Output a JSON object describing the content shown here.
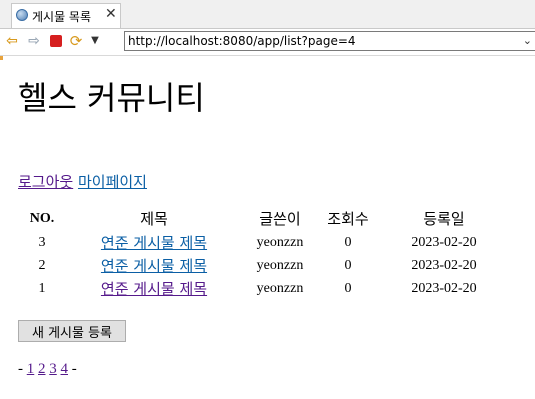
{
  "browser": {
    "tab_title": "게시물 목록",
    "url": "http://localhost:8080/app/list?page=4"
  },
  "page": {
    "title": "헬스 커뮤니티",
    "links": {
      "logout": "로그아웃",
      "mypage": "마이페이지"
    },
    "table": {
      "headers": [
        "NO.",
        "제목",
        "글쓴이",
        "조회수",
        "등록일"
      ],
      "rows": [
        {
          "no": "3",
          "title": "연준 게시물 제목",
          "author": "yeonzzn",
          "views": "0",
          "date": "2023-02-20"
        },
        {
          "no": "2",
          "title": "연준 게시물 제목",
          "author": "yeonzzn",
          "views": "0",
          "date": "2023-02-20"
        },
        {
          "no": "1",
          "title": "연준 게시물 제목",
          "author": "yeonzzn",
          "views": "0",
          "date": "2023-02-20"
        }
      ]
    },
    "new_post_button": "새 게시물 등록",
    "pagination": {
      "prefix": "-",
      "pages": [
        "1",
        "2",
        "3",
        "4"
      ],
      "suffix": "-"
    }
  }
}
